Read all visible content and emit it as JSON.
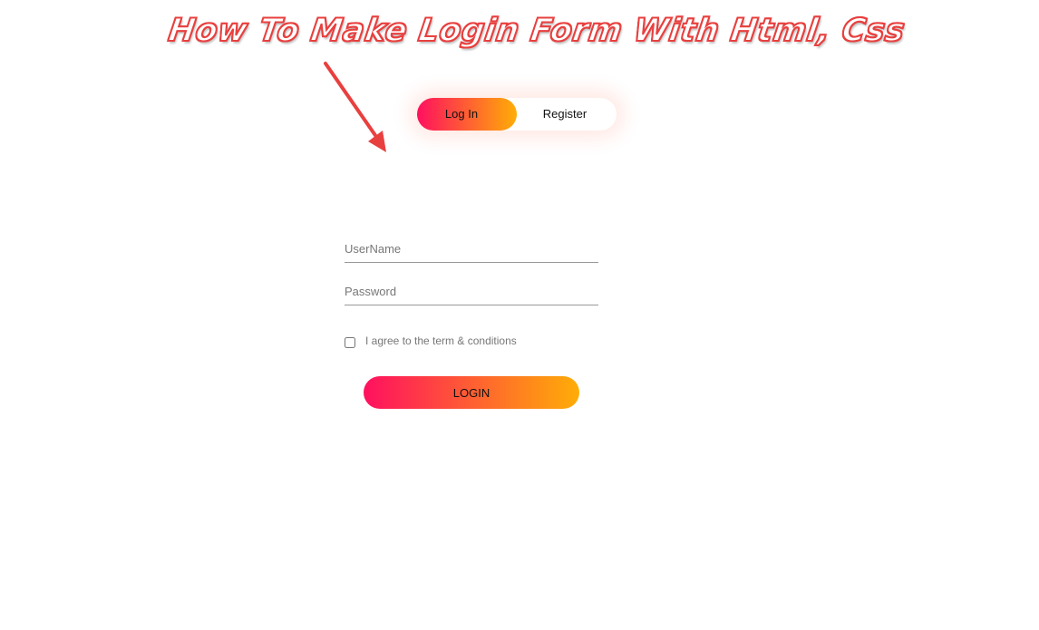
{
  "banner": {
    "title": "How To Make Login Form With Html, Css"
  },
  "toggle": {
    "login_label": "Log In",
    "register_label": "Register",
    "active": "Log In"
  },
  "form": {
    "username_placeholder": "UserName",
    "password_placeholder": "Password",
    "agree_label": "I agree to the term & conditions",
    "agree_checked": false,
    "submit_label": "LOGIN"
  },
  "colors": {
    "gradient_start": "#ff105f",
    "gradient_end": "#ffad06",
    "annotation": "#e8403f"
  }
}
